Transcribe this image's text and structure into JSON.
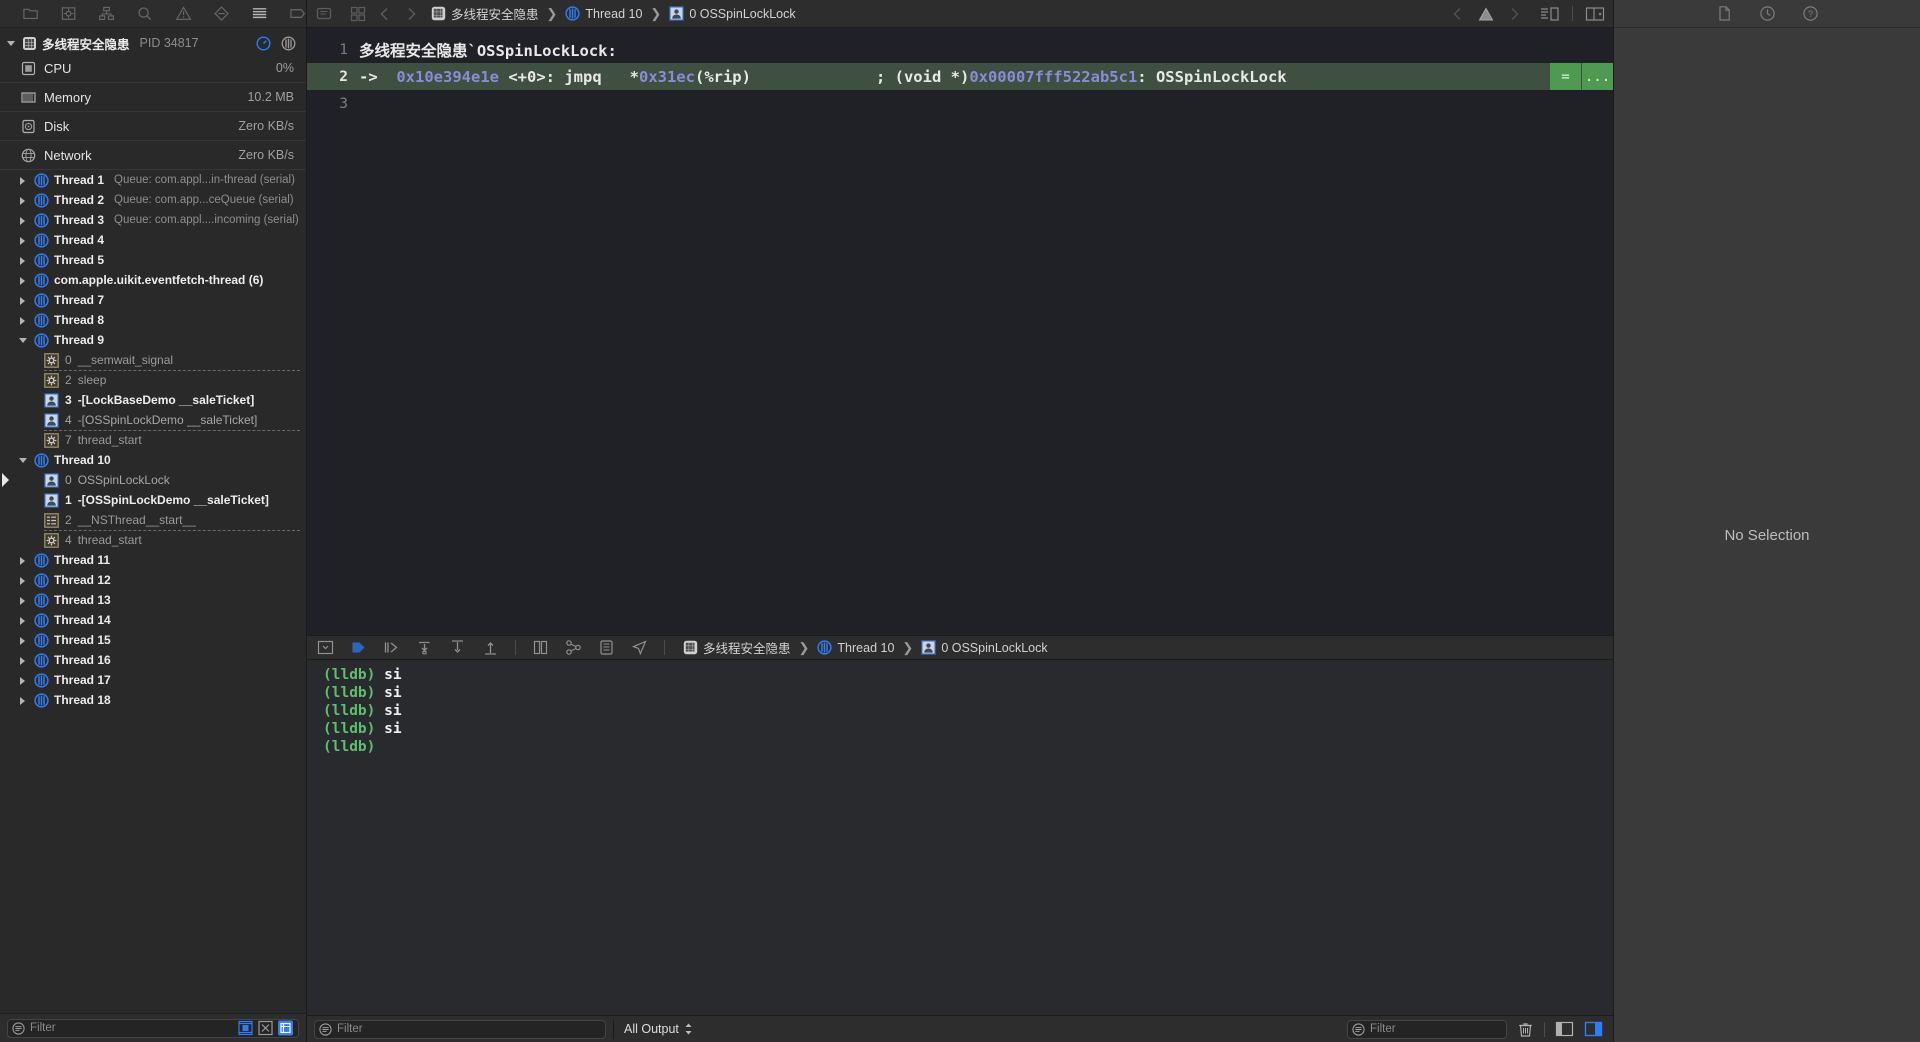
{
  "navigator": {
    "toolbar_icons": [
      "folder-icon",
      "source-control-icon",
      "symbol-hierarchy-icon",
      "find-icon",
      "issue-warning-icon",
      "test-diamond-icon",
      "debug-list-icon",
      "breakpoint-tag-icon"
    ],
    "process": {
      "name": "多线程安全隐患",
      "pid_label": "PID 34817",
      "icon": "app-grid-icon",
      "disclosure": "open",
      "header_icons": [
        "gauge-icon",
        "threads-icon"
      ]
    },
    "gauges": [
      {
        "icon": "cpu-icon",
        "label": "CPU",
        "value": "0%"
      },
      {
        "icon": "memory-icon",
        "label": "Memory",
        "value": "10.2 MB"
      },
      {
        "icon": "disk-icon",
        "label": "Disk",
        "value": "Zero KB/s"
      },
      {
        "icon": "network-icon",
        "label": "Network",
        "value": "Zero KB/s"
      }
    ],
    "threads": [
      {
        "name": "Thread 1",
        "queue": "Queue: com.appl...in-thread (serial)",
        "expanded": false,
        "frames": []
      },
      {
        "name": "Thread 2",
        "queue": "Queue: com.app...ceQueue (serial)",
        "expanded": false,
        "frames": []
      },
      {
        "name": "Thread 3",
        "queue": "Queue: com.appl....incoming (serial)",
        "expanded": false,
        "frames": []
      },
      {
        "name": "Thread 4",
        "queue": "",
        "expanded": false,
        "frames": []
      },
      {
        "name": "Thread 5",
        "queue": "",
        "expanded": false,
        "frames": []
      },
      {
        "name": "com.apple.uikit.eventfetch-thread (6)",
        "queue": "",
        "expanded": false,
        "frames": []
      },
      {
        "name": "Thread 7",
        "queue": "",
        "expanded": false,
        "frames": []
      },
      {
        "name": "Thread 8",
        "queue": "",
        "expanded": false,
        "frames": []
      },
      {
        "name": "Thread 9",
        "queue": "",
        "expanded": true,
        "frames": [
          {
            "num": "0",
            "label": "__semwait_signal",
            "icon": "system-frame-icon",
            "style": "system",
            "dashed": true,
            "pc": false
          },
          {
            "num": "2",
            "label": "sleep",
            "icon": "system-frame-icon",
            "style": "system",
            "dashed": false,
            "pc": false
          },
          {
            "num": "3",
            "label": "-[LockBaseDemo __saleTicket]",
            "icon": "user-frame-icon",
            "style": "user",
            "dashed": false,
            "pc": false
          },
          {
            "num": "4",
            "label": "-[OSSpinLockDemo __saleTicket]",
            "icon": "user-frame-icon",
            "style": "user-dim",
            "dashed": true,
            "pc": false
          },
          {
            "num": "7",
            "label": "thread_start",
            "icon": "system-frame-icon",
            "style": "system",
            "dashed": false,
            "pc": false
          }
        ]
      },
      {
        "name": "Thread 10",
        "queue": "",
        "expanded": true,
        "frames": [
          {
            "num": "0",
            "label": "OSSpinLockLock",
            "icon": "user-frame-icon",
            "style": "user-dim",
            "dashed": false,
            "pc": true
          },
          {
            "num": "1",
            "label": "-[OSSpinLockDemo __saleTicket]",
            "icon": "user-frame-icon",
            "style": "user",
            "dashed": false,
            "pc": false
          },
          {
            "num": "2",
            "label": "__NSThread__start__",
            "icon": "framework-frame-icon",
            "style": "system",
            "dashed": true,
            "pc": false
          },
          {
            "num": "4",
            "label": "thread_start",
            "icon": "system-frame-icon",
            "style": "system",
            "dashed": false,
            "pc": false
          }
        ]
      },
      {
        "name": "Thread 11",
        "queue": "",
        "expanded": false,
        "frames": []
      },
      {
        "name": "Thread 12",
        "queue": "",
        "expanded": false,
        "frames": []
      },
      {
        "name": "Thread 13",
        "queue": "",
        "expanded": false,
        "frames": []
      },
      {
        "name": "Thread 14",
        "queue": "",
        "expanded": false,
        "frames": []
      },
      {
        "name": "Thread 15",
        "queue": "",
        "expanded": false,
        "frames": []
      },
      {
        "name": "Thread 16",
        "queue": "",
        "expanded": false,
        "frames": []
      },
      {
        "name": "Thread 17",
        "queue": "",
        "expanded": false,
        "frames": []
      },
      {
        "name": "Thread 18",
        "queue": "",
        "expanded": false,
        "frames": []
      }
    ],
    "filter": {
      "placeholder": "Filter",
      "value": "",
      "scope_icon": "filter-scope-icon",
      "segments": [
        "show-only-running-blocks-icon",
        "show-only-crash-icon",
        "show-only-user-frames-icon"
      ],
      "active_segment": 2
    }
  },
  "editor": {
    "jump_bar_icon": "related-items-icon",
    "back_icon": "chevron-left-icon",
    "forward_icon": "chevron-right-icon",
    "breadcrumb": [
      {
        "icon": "app-grid-icon",
        "label": "多线程安全隐患"
      },
      {
        "icon": "threads-icon",
        "label": "Thread 10"
      },
      {
        "icon": "user-frame-icon",
        "label": "0 OSSpinLockLock"
      }
    ],
    "right_icons": [
      "chevron-left-icon",
      "warning-triangle-icon",
      "chevron-right-icon",
      "minimap-icon",
      "assistant-editor-icon"
    ],
    "code": {
      "lines": [
        {
          "num": "1",
          "highlight": false,
          "arrow": "",
          "segments": [
            {
              "text": "多线程安全隐患`OSSpinLockLock:",
              "kind": "plain"
            }
          ],
          "badges": []
        },
        {
          "num": "2",
          "highlight": true,
          "arrow": "->",
          "segments": [
            {
              "text": "0x10e394e1e",
              "kind": "addr"
            },
            {
              "text": " <+0>: jmpq   *",
              "kind": "plain"
            },
            {
              "text": "0x31ec",
              "kind": "addr"
            },
            {
              "text": "(%rip)",
              "kind": "plain"
            }
          ],
          "comment": [
            {
              "text": "; (void *)",
              "kind": "plain"
            },
            {
              "text": "0x00007fff522ab5c1",
              "kind": "addr"
            },
            {
              "text": ": OSSpinLockLock",
              "kind": "plain"
            }
          ],
          "badges": [
            "=",
            "..."
          ]
        },
        {
          "num": "3",
          "highlight": false,
          "arrow": "",
          "segments": [
            {
              "text": "",
              "kind": "plain"
            }
          ],
          "badges": []
        }
      ]
    }
  },
  "debug": {
    "toolbar_icons": [
      "hide-debug-area-icon",
      "continue-icon",
      "step-over-icon",
      "step-into-icon",
      "step-out-icon",
      "step-out-alt-icon",
      "view-hierarchy-icon",
      "memory-graph-icon",
      "environment-overrides-icon",
      "location-simulate-icon"
    ],
    "breadcrumb": [
      {
        "icon": "app-grid-icon",
        "label": "多线程安全隐患"
      },
      {
        "icon": "threads-icon",
        "label": "Thread 10"
      },
      {
        "icon": "user-frame-icon",
        "label": "0 OSSpinLockLock"
      }
    ],
    "console_lines": [
      {
        "prompt": "(lldb)",
        "cmd": "si"
      },
      {
        "prompt": "(lldb)",
        "cmd": "si"
      },
      {
        "prompt": "(lldb)",
        "cmd": "si"
      },
      {
        "prompt": "(lldb)",
        "cmd": "si"
      },
      {
        "prompt": "(lldb)",
        "cmd": ""
      }
    ]
  },
  "status_bar": {
    "output_scope": "All Output",
    "stepper_icon": "up-down-chevrons-icon",
    "console_filter_placeholder": "Filter",
    "console_filter_value": "",
    "trash_icon": "trash-icon",
    "pane_icons": [
      "show-variables-view-icon",
      "show-console-view-icon"
    ],
    "active_pane": 1
  },
  "inspector": {
    "tabs": [
      "file-inspector-icon",
      "history-inspector-icon",
      "quick-help-icon"
    ],
    "empty_text": "No Selection"
  },
  "colors": {
    "accent": "#2f7cf6",
    "highlight_line": "#3f5040",
    "badge_green": "#4e9a51",
    "prompt_green": "#5fbf6f",
    "addr_purple": "#8b8bd8",
    "nav_bg": "#292929",
    "editor_bg": "#1f2126",
    "console_bg": "#282a2e",
    "inspector_bg": "#3a3a3a"
  }
}
